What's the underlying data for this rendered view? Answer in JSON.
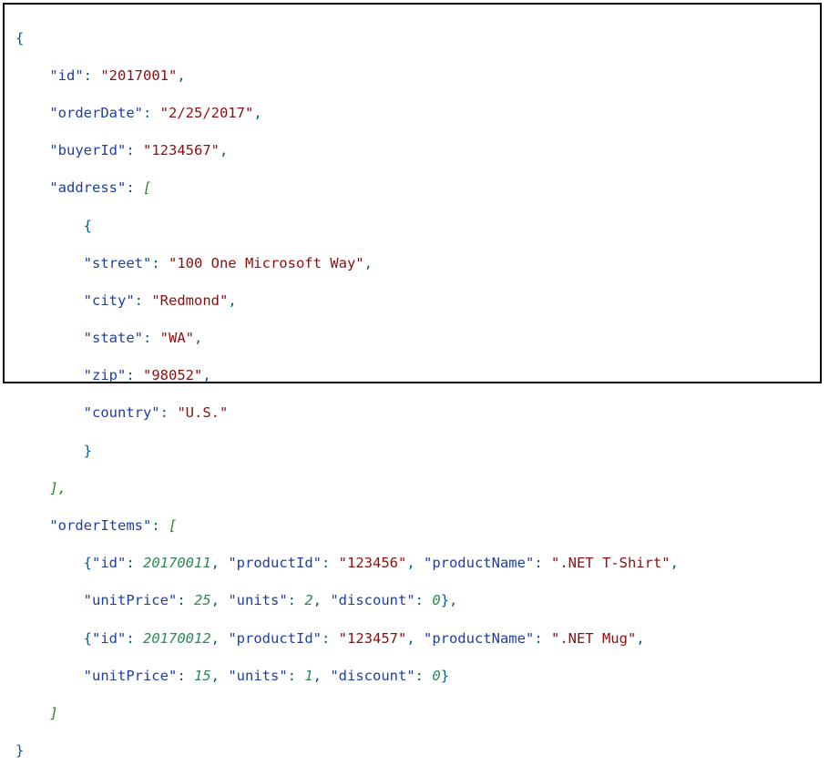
{
  "code": {
    "l1": "{",
    "l2_key": "\"id\"",
    "l2_val": "\"2017001\"",
    "l3_key": "\"orderDate\"",
    "l3_val": "\"2/25/2017\"",
    "l4_key": "\"buyerId\"",
    "l4_val": "\"1234567\"",
    "l5_key": "\"address\"",
    "l5_open": "[",
    "l6": "{",
    "l7_key": "\"street\"",
    "l7_val": "\"100 One Microsoft Way\"",
    "l8_key": "\"city\"",
    "l8_val": "\"Redmond\"",
    "l9_key": "\"state\"",
    "l9_val": "\"WA\"",
    "l10_key": "\"zip\"",
    "l10_val": "\"98052\"",
    "l11_key": "\"country\"",
    "l11_val": "\"U.S.\"",
    "l12": "}",
    "l13": "],",
    "l14_key": "\"orderItems\"",
    "l14_open": "[",
    "l15_k1": "\"id\"",
    "l15_v1": "20170011",
    "l15_k2": "\"productId\"",
    "l15_v2": "\"123456\"",
    "l15_k3": "\"productName\"",
    "l15_v3": "\".NET T-Shirt\"",
    "l16_k1": "\"unitPrice\"",
    "l16_v1": "25",
    "l16_k2": "\"units\"",
    "l16_v2": "2",
    "l16_k3": "\"discount\"",
    "l16_v3": "0",
    "l17_k1": "\"id\"",
    "l17_v1": "20170012",
    "l17_k2": "\"productId\"",
    "l17_v2": "\"123457\"",
    "l17_k3": "\"productName\"",
    "l17_v3": "\".NET Mug\"",
    "l18_k1": "\"unitPrice\"",
    "l18_v1": "15",
    "l18_k2": "\"units\"",
    "l18_v2": "1",
    "l18_k3": "\"discount\"",
    "l18_v3": "0",
    "l19": "]",
    "l20": "}"
  }
}
